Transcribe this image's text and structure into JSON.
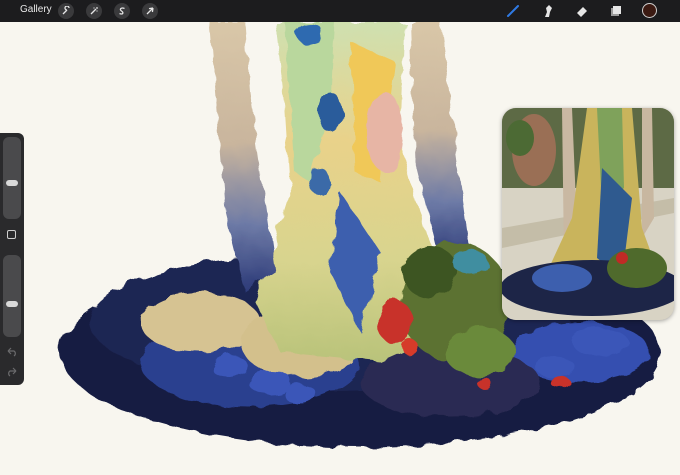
{
  "topbar": {
    "gallery_label": "Gallery",
    "tools_left": [
      {
        "name": "actions",
        "icon": "wrench-icon"
      },
      {
        "name": "adjustments",
        "icon": "magic-wand-icon"
      },
      {
        "name": "selection",
        "icon": "selection-s-icon"
      },
      {
        "name": "transform",
        "icon": "arrow-cursor-icon"
      }
    ],
    "tools_right": [
      {
        "name": "brush",
        "icon": "brush-icon",
        "active": true
      },
      {
        "name": "smudge",
        "icon": "smudge-icon"
      },
      {
        "name": "eraser",
        "icon": "eraser-icon"
      },
      {
        "name": "layers",
        "icon": "layers-icon"
      }
    ],
    "active_color": "#3b1a12",
    "accent_color": "#2f7ae5"
  },
  "sidebar": {
    "brush_size_level": 0.68,
    "opacity_level": 0.4,
    "modify_icon": "square-icon",
    "undo_icon": "undo-arrow-icon",
    "redo_icon": "redo-arrow-icon"
  },
  "reference_window": {
    "icon": "reference-photo-image"
  }
}
